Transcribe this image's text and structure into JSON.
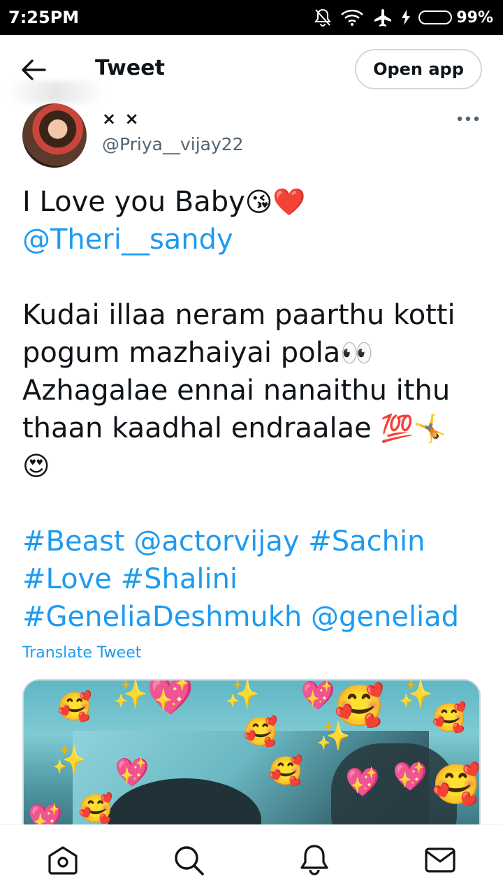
{
  "status_bar": {
    "time": "7:25PM",
    "battery": "99%"
  },
  "header": {
    "title": "Tweet",
    "open_app_label": "Open app"
  },
  "author": {
    "display_name": "× ×",
    "handle": "@Priya__vijay22"
  },
  "tweet": {
    "line1_text": "I Love you Baby",
    "line1_emoji": "😘❤️",
    "mention_1": "@Theri__sandy",
    "para2_line1": "Kudai illaa neram paarthu kotti",
    "para2_line2": "pogum mazhaiyai pola",
    "para2_line2_emoji": "👀",
    "para2_line3": "Azhagalae ennai nanaithu ithu",
    "para2_line4": "thaan kaadhal endraalae ",
    "para2_line4_emoji": "💯🤸",
    "para2_line5_emoji": "😍",
    "hashtag_beast": "#Beast",
    "mention_actorvijay": "@actorvijay",
    "hashtag_sachin": "#Sachin",
    "hashtag_love": "#Love",
    "hashtag_shalini": "#Shalini",
    "hashtag_genelia": "#GeneliaDeshmukh",
    "mention_geneliad": "@geneliad"
  },
  "translate_label": "Translate Tweet",
  "media": {
    "stickers": [
      "🥰",
      "✨",
      "💖",
      "✨",
      "💖",
      "🥰",
      "✨",
      "🥰",
      "🥰",
      "✨",
      "💖",
      "🥰",
      "✨",
      "💖",
      "💖",
      "🥰",
      "💖",
      "🥰"
    ]
  },
  "bottom_nav": {
    "icons": [
      "home-icon",
      "search-icon",
      "notifications-icon",
      "messages-icon"
    ]
  },
  "colors": {
    "link": "#1d9bf0",
    "secondary_text": "#536471",
    "border": "#cfd9de"
  }
}
